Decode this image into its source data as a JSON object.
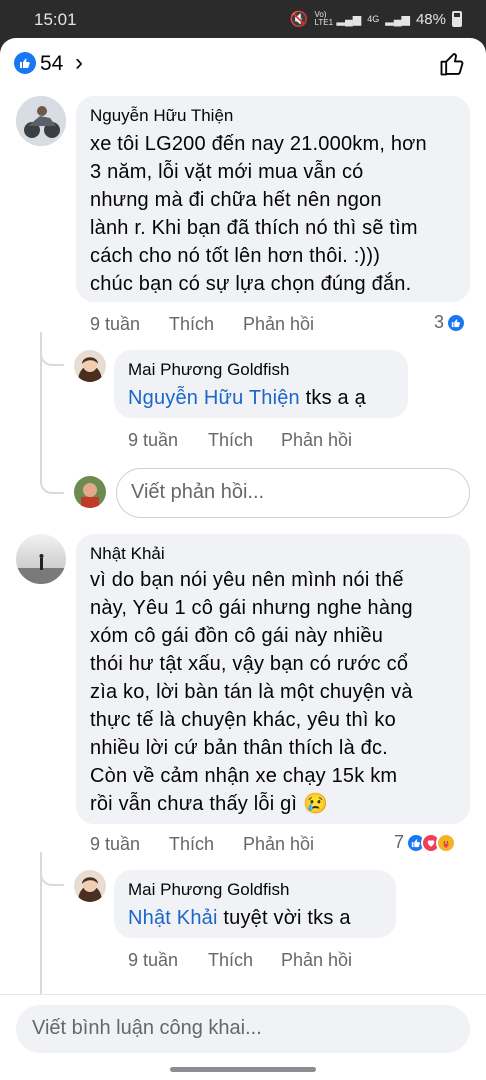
{
  "status": {
    "time": "15:01",
    "battery": "48%",
    "network": "Vo) LTE1",
    "signal_label": "4G"
  },
  "header": {
    "like_count": "54",
    "chevron": "›"
  },
  "comments": [
    {
      "author": "Nguyễn Hữu Thiện",
      "lines": [
        "xe tôi LG200 đến nay 21.000km, hơn",
        "3 năm, lỗi vặt mới mua vẫn có",
        "nhưng mà đi chữa hết nên ngon",
        "lành r. Khi bạn đã thích nó thì sẽ tìm",
        "cách cho nó tốt lên hơn thôi. :)))",
        "chúc bạn có sự lựa chọn đúng đắn."
      ],
      "time": "9 tuần",
      "like": "Thích",
      "reply": "Phản hồi",
      "reaction_count": "3",
      "replies": [
        {
          "author": "Mai Phương Goldfish",
          "mention": "Nguyễn Hữu Thiện",
          "text": " tks a ạ",
          "time": "9 tuần",
          "like": "Thích",
          "reply": "Phản hồi"
        }
      ],
      "reply_placeholder": "Viết phản hồi..."
    },
    {
      "author": "Nhật Khải",
      "lines": [
        "vì do bạn nói yêu nên mình nói thế",
        "này, Yêu 1 cô gái nhưng nghe hàng",
        "xóm cô gái đồn cô gái này nhiều",
        "thói hư tật xấu, vậy bạn có rước cổ",
        "zìa ko, lời bàn tán là một chuyện và",
        "thực tế là chuyện khác, yêu thì ko",
        "nhiều lời cứ bản thân thích là đc.",
        "Còn về cảm nhận xe chạy 15k km",
        "rồi vẫn chưa thấy lỗi gì 😢"
      ],
      "time": "9 tuần",
      "like": "Thích",
      "reply": "Phản hồi",
      "reaction_count": "7",
      "replies": [
        {
          "author": "Mai Phương Goldfish",
          "mention": "Nhật Khải",
          "text": " tuyệt vời tks a",
          "time": "9 tuần",
          "like": "Thích",
          "reply": "Phản hồi"
        }
      ]
    }
  ],
  "composer": {
    "placeholder": "Viết bình luận công khai..."
  },
  "colors": {
    "link": "#1b66c9",
    "like_blue": "#1877f2",
    "bubble": "#f0f2f5",
    "love": "#f33e58",
    "haha": "#f7b125"
  }
}
